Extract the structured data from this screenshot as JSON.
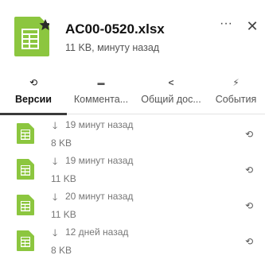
{
  "header": {
    "title": "AC00-0520.xlsx",
    "subtitle": "11 KB, минуту назад",
    "more_icon": "more-dots-icon",
    "more_label": "···",
    "close_icon": "close-icon",
    "close_label": "✕",
    "file_icon": "spreadsheet-file-icon",
    "star_icon": "star-icon"
  },
  "colors": {
    "accent_green": "#8cc63f",
    "text_dark": "#111111",
    "text_muted": "#777777"
  },
  "tabs": [
    {
      "label": "Версии",
      "icon": "history-icon",
      "glyph": "⟲",
      "active": true
    },
    {
      "label": "Коммента...",
      "icon": "comment-icon",
      "glyph": "▬",
      "active": false
    },
    {
      "label": "Общий дос...",
      "icon": "share-icon",
      "glyph": "<",
      "active": false
    },
    {
      "label": "События",
      "icon": "lightning-icon",
      "glyph": "⚡",
      "active": false
    }
  ],
  "versions": [
    {
      "time": "19 минут назад",
      "size": "8 KB"
    },
    {
      "time": "19 минут назад",
      "size": "11 KB"
    },
    {
      "time": "20 минут назад",
      "size": "11 KB"
    },
    {
      "time": "12 дней назад",
      "size": "8 KB"
    }
  ],
  "version_icons": {
    "file": "spreadsheet-file-icon",
    "download": "download-arrow-icon",
    "download_glyph": "🡓",
    "restore": "restore-icon",
    "restore_glyph": "⟲"
  }
}
